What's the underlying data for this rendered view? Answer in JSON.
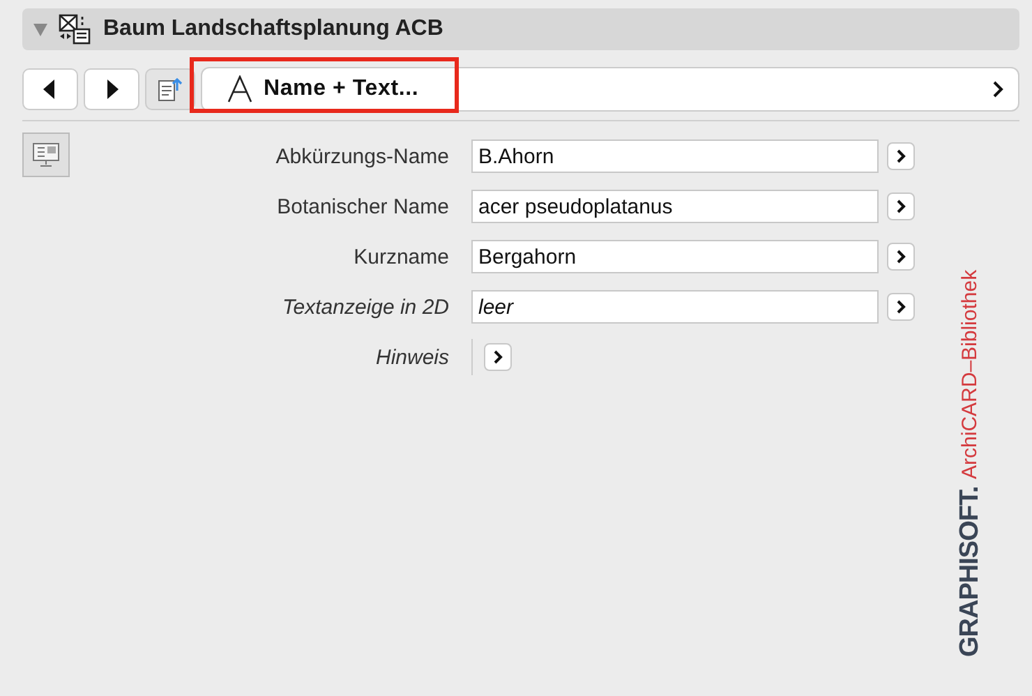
{
  "header": {
    "title": "Baum Landschaftsplanung ACB",
    "expanded": true
  },
  "toolbar": {
    "page_button": "Name + Text...",
    "highlighted": true
  },
  "fields": [
    {
      "kind": "field",
      "label": "Abkürzungs-Name",
      "value": "B.Ahorn",
      "italic": false
    },
    {
      "kind": "field",
      "label": "Botanischer Name",
      "value": "acer pseudoplatanus",
      "italic": false
    },
    {
      "kind": "field",
      "label": "Kurzname",
      "value": "Bergahorn",
      "italic": false
    },
    {
      "kind": "field",
      "label": "Textanzeige in 2D",
      "value": "leer",
      "italic": true
    },
    {
      "kind": "note",
      "label": "Hinweis",
      "italic": true
    }
  ],
  "logo": {
    "brand": "GRAPHISOFT.",
    "library": "ArchiCARD–Bibliothek"
  }
}
